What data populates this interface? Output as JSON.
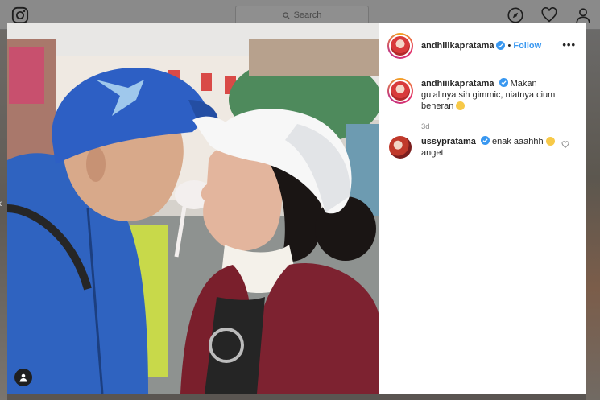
{
  "search": {
    "placeholder": "Search"
  },
  "post": {
    "author": "andhiiikapratama",
    "follow_label": "Follow",
    "separator": "•",
    "more_label": "•••",
    "caption": "Makan gulalinya sih gimmic, niatnya cium beneran",
    "time_ago": "3d"
  },
  "comments": [
    {
      "username": "ussypratama",
      "text": "enak aaahhh",
      "text2": "anget"
    }
  ],
  "colors": {
    "follow": "#3897f0",
    "verified": "#3897f0"
  }
}
